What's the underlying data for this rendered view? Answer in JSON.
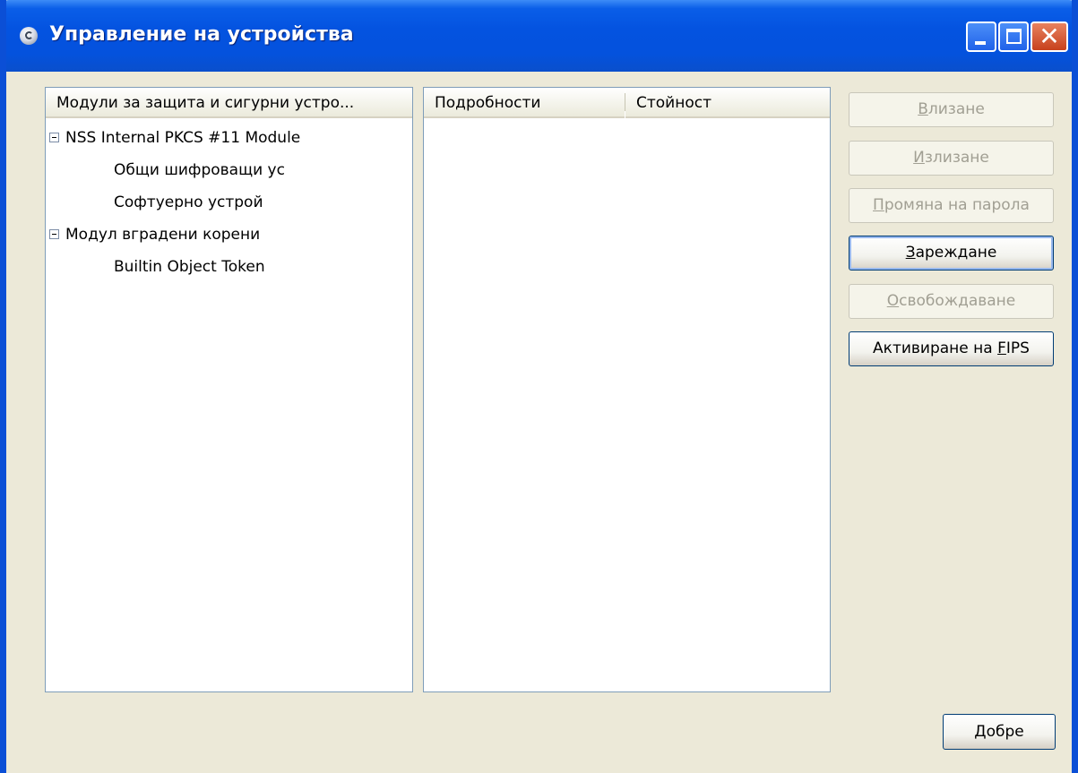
{
  "window": {
    "title": "Управление на устройства"
  },
  "tree": {
    "column_header": "Модули за защита и сигурни устро...",
    "items": [
      {
        "label": "NSS Internal PKCS #11 Module",
        "level": 0,
        "expanded": true
      },
      {
        "label": "Общи шифроващи ус",
        "level": 1
      },
      {
        "label": "Софтуерно устрой",
        "level": 1
      },
      {
        "label": "Модул вградени корени",
        "level": 0,
        "expanded": true
      },
      {
        "label": "Builtin Object Token",
        "level": 1
      }
    ]
  },
  "details": {
    "columns": [
      "Подробности",
      "Стойност"
    ]
  },
  "buttons": {
    "login": {
      "pre": "",
      "key": "В",
      "post": "лизане",
      "enabled": false
    },
    "logout": {
      "pre": "",
      "key": "И",
      "post": "злизане",
      "enabled": false
    },
    "change_password": {
      "pre": "",
      "key": "П",
      "post": "ромяна на парола",
      "enabled": false
    },
    "load": {
      "pre": "",
      "key": "З",
      "post": "ареждане",
      "enabled": true
    },
    "unload": {
      "pre": "",
      "key": "О",
      "post": "свобождаване",
      "enabled": false
    },
    "enable_fips": {
      "pre": "Активиране на ",
      "key": "F",
      "post": "IPS",
      "enabled": true
    },
    "ok": {
      "pre": "",
      "key": "Д",
      "post": "обре",
      "enabled": true
    }
  }
}
